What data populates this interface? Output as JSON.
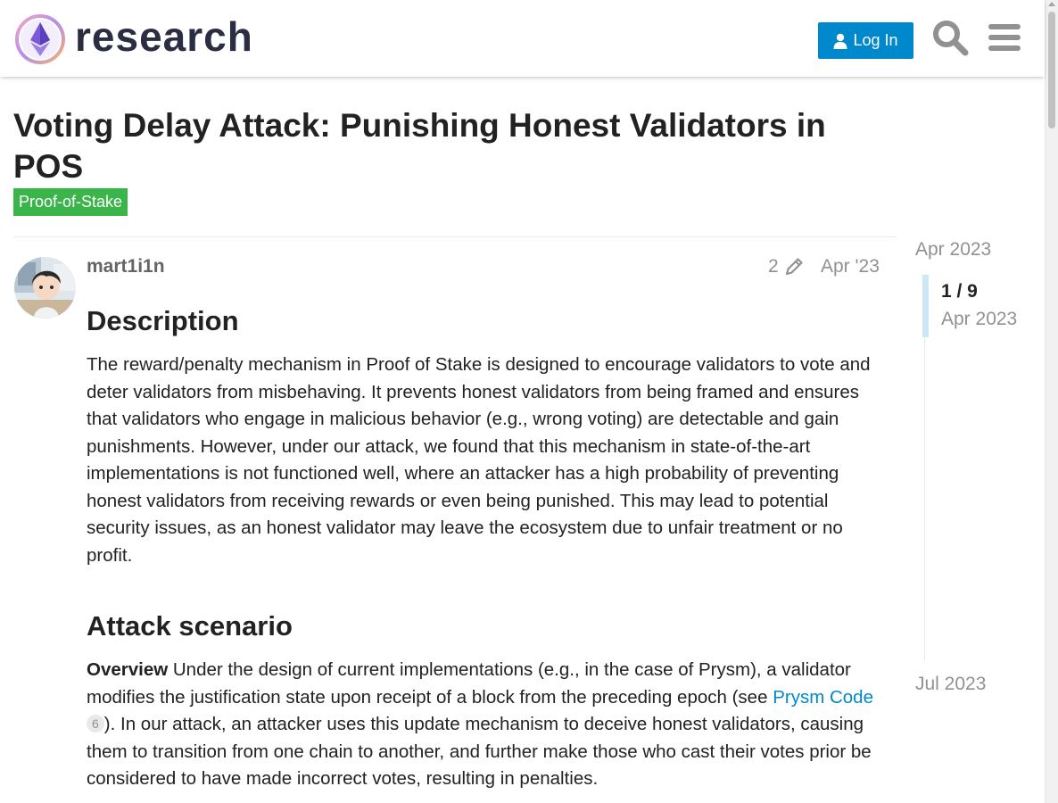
{
  "header": {
    "logo_text": "research",
    "login_label": "Log In",
    "search_icon": "search-icon",
    "menu_icon": "hamburger-menu-icon"
  },
  "topic": {
    "title": "Voting Delay Attack: Punishing Honest Validators in POS",
    "category": "Proof-of-Stake",
    "category_color": "#3ab54a"
  },
  "post": {
    "username": "mart1i1n",
    "edit_count": "2",
    "date": "Apr '23",
    "sections": {
      "description_heading": "Description",
      "description_text": "The reward/penalty mechanism in Proof of Stake is designed to encourage validators to vote and deter validators from misbehaving. It prevents honest validators from being framed and ensures that validators who engage in malicious behavior (e.g., wrong voting) are detectable and gain punishments. However, under our attack, we found that this mechanism in state-of-the-art implementations is not functioned well, where an attacker has a high probability of preventing honest validators from receiving rewards or even being punished. This may lead to potential security issues, as an honest validator may leave the ecosystem due to unfair treatment or no profit.",
      "attack_heading": "Attack scenario",
      "overview_label": "Overview",
      "overview_text_1": " Under the design of current implementations (e.g., in the case of Prysm), a validator modifies the justification state upon receipt of a block from the preceding epoch (see ",
      "link_text": "Prysm Code",
      "link_clicks": "6",
      "overview_text_2": "). In our attack, an attacker uses this update mechanism to deceive honest validators, causing them to transition from one chain to another, and further make those who cast their votes prior be considered to have made incorrect votes, resulting in penalties."
    }
  },
  "timeline": {
    "start_date": "Apr 2023",
    "progress": "1 / 9",
    "progress_date": "Apr 2023",
    "end_date": "Jul 2023"
  },
  "colors": {
    "accent": "#0088cc",
    "muted_text": "#919191"
  }
}
